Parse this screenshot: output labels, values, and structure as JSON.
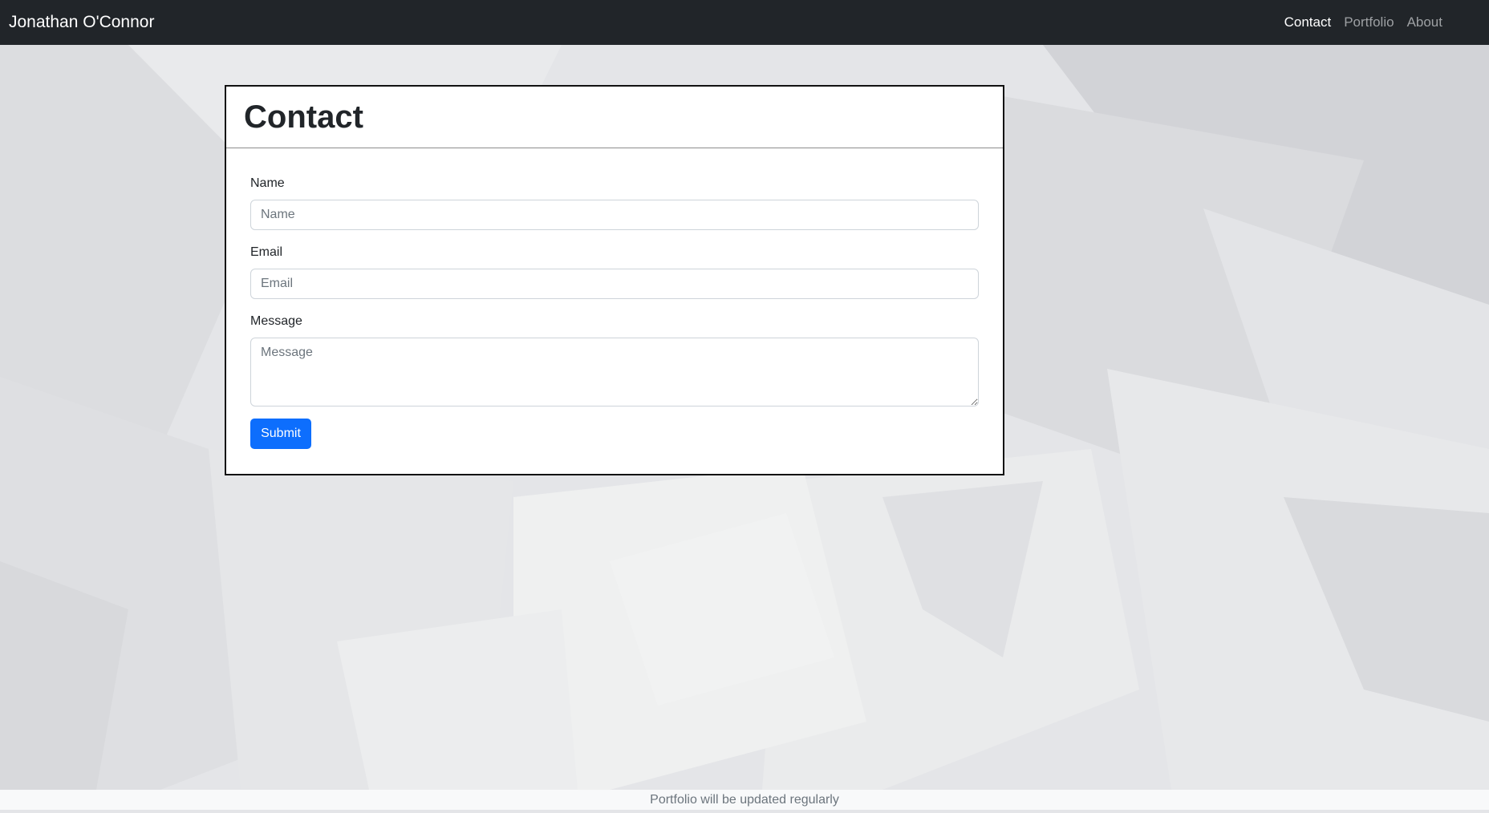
{
  "navbar": {
    "brand": "Jonathan O'Connor",
    "links": [
      {
        "label": "Contact",
        "active": true
      },
      {
        "label": "Portfolio",
        "active": false
      },
      {
        "label": "About",
        "active": false
      }
    ]
  },
  "contact_card": {
    "title": "Contact",
    "name_label": "Name",
    "name_placeholder": "Name",
    "email_label": "Email",
    "email_placeholder": "Email",
    "message_label": "Message",
    "message_placeholder": "Message",
    "submit_label": "Submit"
  },
  "footer": {
    "text": "Portfolio will be updated regularly"
  },
  "colors": {
    "navbar_bg": "#212529",
    "primary": "#0d6efd",
    "footer_bg": "#f8f9fa"
  }
}
